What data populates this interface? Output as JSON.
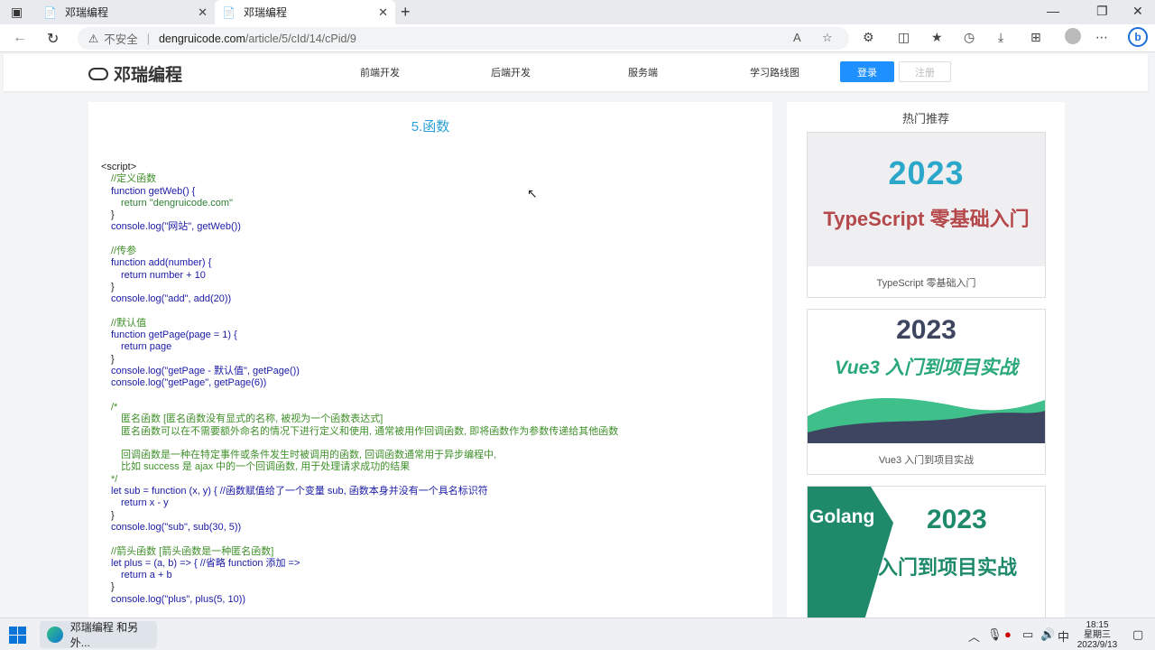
{
  "browser": {
    "tabs": [
      {
        "title": "邓瑞编程",
        "active": false
      },
      {
        "title": "邓瑞编程",
        "active": true
      }
    ],
    "new_tab": "+",
    "window_controls": [
      "—",
      "❐",
      "✕"
    ],
    "address": {
      "security_label": "不安全",
      "domain": "dengruicode.com",
      "path": "/article/5/cId/14/cPid/9"
    }
  },
  "site": {
    "logo_text": "邓瑞编程",
    "nav": [
      "前端开发",
      "后端开发",
      "服务端",
      "学习路线图"
    ],
    "login_label": "登录",
    "register_label": "注册"
  },
  "article": {
    "title": "5.函数",
    "code_lines": [
      {
        "t": "<script>",
        "c": "plain",
        "i": 0
      },
      {
        "t": "//定义函数",
        "c": "cm",
        "i": 1
      },
      {
        "t": "function getWeb() {",
        "c": "kw",
        "i": 1
      },
      {
        "t": "return \"dengruicode.com\"",
        "c": "str",
        "i": 2
      },
      {
        "t": "}",
        "c": "plain",
        "i": 1
      },
      {
        "t": "console.log(\"网站\", getWeb())",
        "c": "kw",
        "i": 1
      },
      {
        "t": "",
        "c": "plain",
        "i": 0
      },
      {
        "t": "//传参",
        "c": "cm",
        "i": 1
      },
      {
        "t": "function add(number) {",
        "c": "kw",
        "i": 1
      },
      {
        "t": "return number + 10",
        "c": "kw",
        "i": 2
      },
      {
        "t": "}",
        "c": "plain",
        "i": 1
      },
      {
        "t": "console.log(\"add\", add(20))",
        "c": "kw",
        "i": 1
      },
      {
        "t": "",
        "c": "plain",
        "i": 0
      },
      {
        "t": "//默认值",
        "c": "cm",
        "i": 1
      },
      {
        "t": "function getPage(page = 1) {",
        "c": "kw",
        "i": 1
      },
      {
        "t": "return page",
        "c": "kw",
        "i": 2
      },
      {
        "t": "}",
        "c": "plain",
        "i": 1
      },
      {
        "t": "console.log(\"getPage - 默认值\", getPage())",
        "c": "kw",
        "i": 1
      },
      {
        "t": "console.log(\"getPage\", getPage(6))",
        "c": "kw",
        "i": 1
      },
      {
        "t": "",
        "c": "plain",
        "i": 0
      },
      {
        "t": "/*",
        "c": "cm",
        "i": 1
      },
      {
        "t": "匿名函数 [匿名函数没有显式的名称, 被视为一个函数表达式]",
        "c": "cm",
        "i": 2
      },
      {
        "t": "匿名函数可以在不需要额外命名的情况下进行定义和使用, 通常被用作回调函数, 即将函数作为参数传递给其他函数",
        "c": "cm",
        "i": 2
      },
      {
        "t": "",
        "c": "plain",
        "i": 0
      },
      {
        "t": "回调函数是一种在特定事件或条件发生时被调用的函数, 回调函数通常用于异步编程中,",
        "c": "cm",
        "i": 2
      },
      {
        "t": "比如 success 是 ajax 中的一个回调函数, 用于处理请求成功的结果",
        "c": "cm",
        "i": 2
      },
      {
        "t": "*/",
        "c": "cm",
        "i": 1
      },
      {
        "t": "let sub = function (x, y) { //函数赋值给了一个变量 sub, 函数本身并没有一个具名标识符",
        "c": "kw",
        "i": 1
      },
      {
        "t": "return x - y",
        "c": "kw",
        "i": 2
      },
      {
        "t": "}",
        "c": "plain",
        "i": 1
      },
      {
        "t": "console.log(\"sub\", sub(30, 5))",
        "c": "kw",
        "i": 1
      },
      {
        "t": "",
        "c": "plain",
        "i": 0
      },
      {
        "t": "//箭头函数 [箭头函数是一种匿名函数]",
        "c": "cm",
        "i": 1
      },
      {
        "t": "let plus = (a, b) => { //省略 function 添加 =>",
        "c": "kw",
        "i": 1
      },
      {
        "t": "return a + b",
        "c": "kw",
        "i": 2
      },
      {
        "t": "}",
        "c": "plain",
        "i": 1
      },
      {
        "t": "console.log(\"plus\", plus(5, 10))",
        "c": "kw",
        "i": 1
      }
    ]
  },
  "sidebar": {
    "heading": "热门推荐",
    "cards": [
      {
        "year": "2023",
        "banner": "TypeScript 零基础入门",
        "caption": "TypeScript 零基础入门"
      },
      {
        "year": "2023",
        "banner": "Vue3 入门到项目实战",
        "caption": "Vue3 入门到项目实战"
      },
      {
        "year": "2023",
        "banner_left": "Golang",
        "banner": "入门到项目实战",
        "caption": ""
      }
    ]
  },
  "taskbar": {
    "app_label": "邓瑞编程 和另外...",
    "ime": "中",
    "time": "18:15",
    "weekday": "星期三",
    "date": "2023/9/13"
  }
}
